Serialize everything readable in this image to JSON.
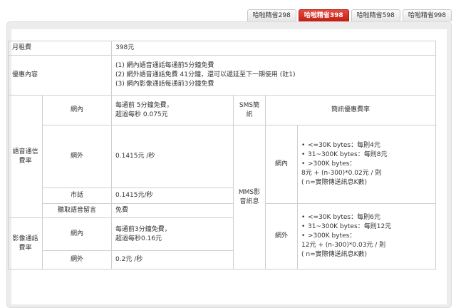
{
  "tabs": [
    {
      "label": "哈啦精省298",
      "active": false
    },
    {
      "label": "哈啦精省398",
      "active": true
    },
    {
      "label": "哈啦精省598",
      "active": false
    },
    {
      "label": "哈啦精省998",
      "active": false
    }
  ],
  "table": {
    "monthly_fee": {
      "label": "月租費",
      "value": "398元"
    },
    "discount": {
      "label": "優惠內容",
      "lines": [
        "(1) 網內語音通話每通前5分鐘免費",
        "(2) 網外語音通話免費 41分鐘，還可以遞延至下一期使用 (註1)",
        "(3) 網內影像通話每通前3分鐘免費"
      ]
    },
    "voice": {
      "label": "語音通信費率",
      "onnet": {
        "label": "網內",
        "lines": [
          "每通前 5分鐘免費，",
          "超過每秒 0.075元"
        ]
      },
      "offnet": {
        "label": "網外",
        "value": "0.1415元 /秒"
      },
      "landline": {
        "label": "市話",
        "value": "0.1415元/秒"
      },
      "voicemail": {
        "label": "聽取語音留言",
        "value": "免費"
      }
    },
    "video": {
      "label": "影像通話費率",
      "onnet": {
        "label": "網內",
        "lines": [
          "每通前3分鐘免費，",
          "超過每秒0.16元"
        ]
      },
      "offnet": {
        "label": "網外",
        "value": "0.2元 /秒"
      }
    },
    "sms": {
      "label": "SMS簡訊",
      "value": "簡訊優惠費率"
    },
    "mms": {
      "label": "MMS影音訊息",
      "onnet": {
        "label": "網內",
        "items": [
          "<=30K bytes：每則4元",
          "31~300K bytes：每則8元",
          ">300K bytes："
        ],
        "extra": [
          "8元 + (n-300)*0.02元 / 則",
          "( n=實際傳送訊息K數)"
        ]
      },
      "offnet": {
        "label": "網外",
        "items": [
          "<=30K bytes：每則6元",
          "31~300K bytes：每則12元",
          ">300K bytes："
        ],
        "extra": [
          "12元 + (n-300)*0.03元 / 則",
          "( n=實際傳送訊息K數)"
        ]
      }
    }
  },
  "colors": {
    "active_tab": "#d42d22",
    "sms_link": "#b8206d"
  }
}
